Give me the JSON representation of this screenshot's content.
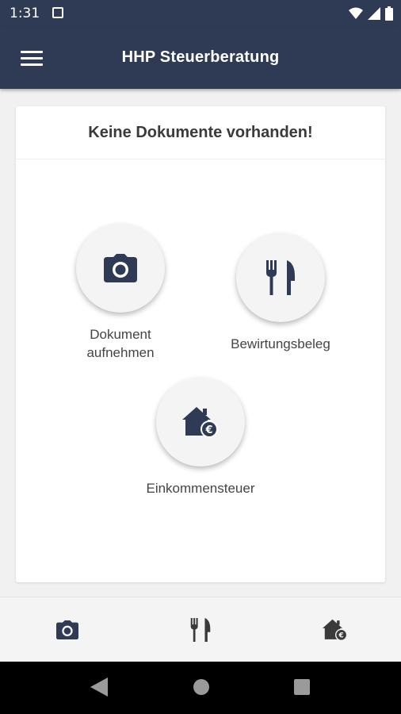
{
  "status_bar": {
    "time": "1:31"
  },
  "app_bar": {
    "title": "HHP Steuerberatung"
  },
  "card": {
    "title": "Keine Dokumente vorhanden!"
  },
  "actions": [
    {
      "label": "Dokument\naufnehmen",
      "icon": "camera-icon"
    },
    {
      "label": "Bewirtungsbeleg",
      "icon": "cutlery-icon"
    },
    {
      "label": "Einkommensteuer",
      "icon": "house-euro-icon"
    }
  ],
  "bottom_nav": [
    {
      "icon": "camera-icon"
    },
    {
      "icon": "cutlery-icon"
    },
    {
      "icon": "house-euro-icon"
    }
  ],
  "colors": {
    "primary": "#2f3b55",
    "background": "#f1f1f1",
    "card": "#ffffff"
  }
}
